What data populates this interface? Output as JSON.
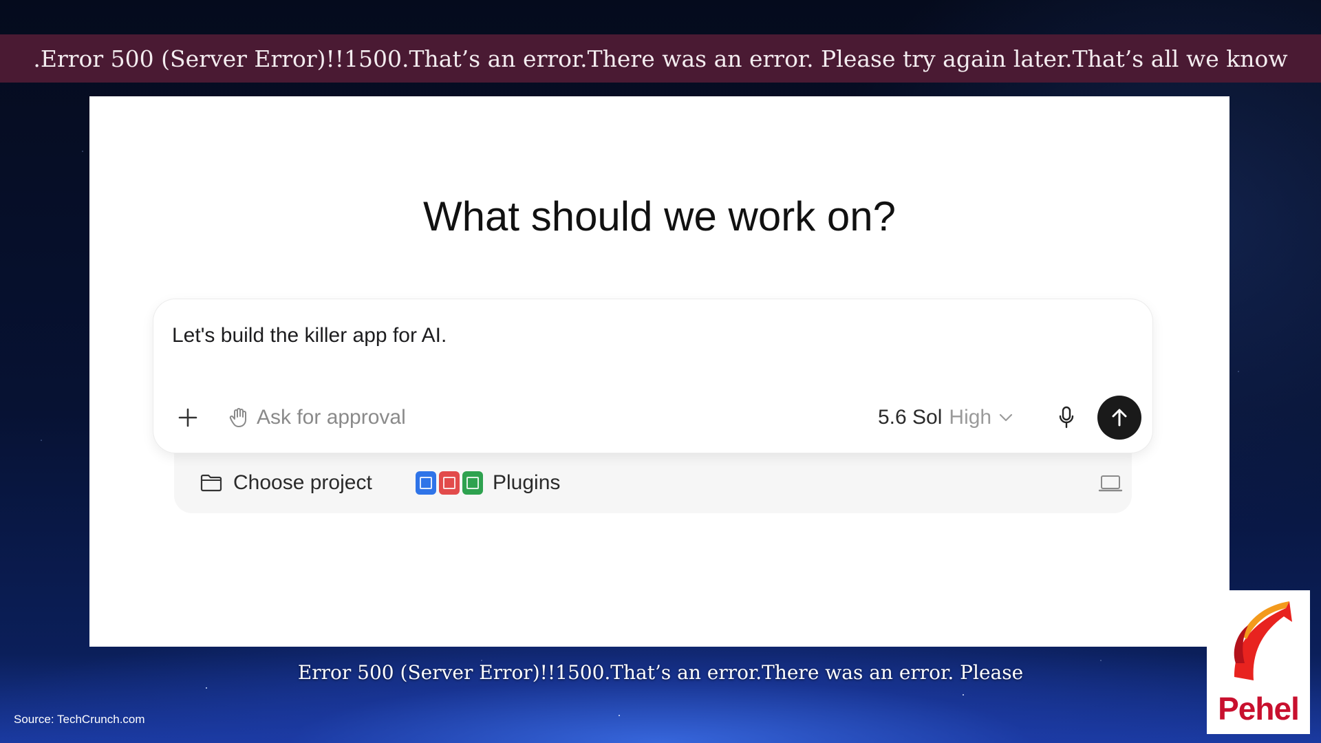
{
  "top_banner": {
    "text": ".Error 500 (Server Error)!!1500.That’s an error.There was an error. Please try again later.That’s all we know"
  },
  "app": {
    "headline": "What should we work on?",
    "composer": {
      "prompt_text": "Let's build the killer app for AI.",
      "approval_label": "Ask for approval",
      "model_name": "5.6 Sol",
      "model_effort": "High"
    },
    "subbar": {
      "project_label": "Choose project",
      "plugins_label": "Plugins"
    }
  },
  "caption": {
    "text": "Error 500 (Server Error)!!1500.That’s an error.There was an error. Please"
  },
  "source": {
    "text": "Source: TechCrunch.com"
  },
  "logo": {
    "wordmark": "Pehel"
  },
  "colors": {
    "banner_bg": "#4a1a33",
    "send_button": "#1a1a1a",
    "logo_red": "#c8102e"
  },
  "icons": [
    "plus-icon",
    "hand-icon",
    "chevron-down-icon",
    "microphone-icon",
    "arrow-up-icon",
    "folder-icon",
    "docs-icon",
    "pdf-icon",
    "sheets-icon",
    "laptop-icon"
  ]
}
